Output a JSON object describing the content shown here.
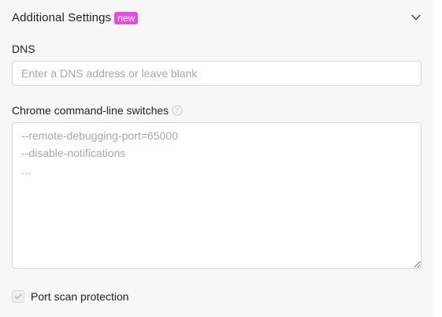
{
  "section": {
    "title": "Additional Settings",
    "badge": "new",
    "collapse_icon": "chevron-down-icon"
  },
  "dns": {
    "label": "DNS",
    "value": "",
    "placeholder": "Enter a DNS address or leave blank"
  },
  "chrome_switches": {
    "label": "Chrome command-line switches",
    "help_icon": "question-circle-icon",
    "value": "",
    "placeholder": "--remote-debugging-port=65000\n--disable-notifications\n..."
  },
  "port_scan": {
    "label": "Port scan protection",
    "checked": true,
    "disabled": true
  },
  "colors": {
    "badge_bg": "#e54fd6",
    "panel_bg": "#f7f7f7",
    "border": "#d9d9d9",
    "placeholder": "#a8a8a8"
  }
}
